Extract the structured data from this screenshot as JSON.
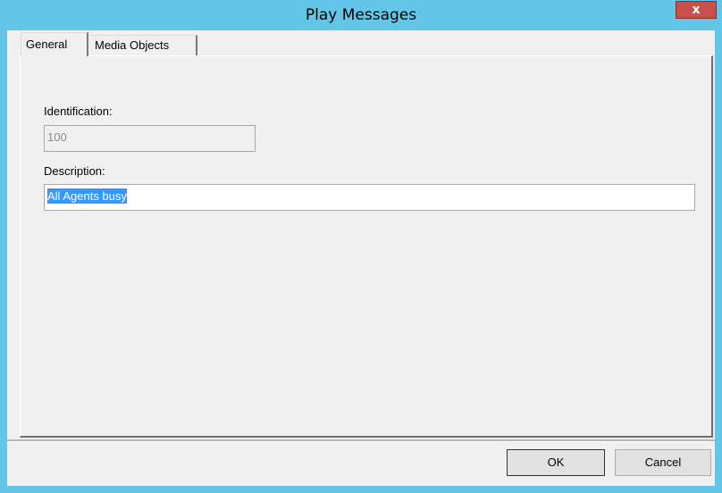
{
  "window": {
    "title": "Play Messages",
    "close_label": "x",
    "colors": {
      "titlebar": "#63c6e8",
      "close_button": "#c7504b",
      "panel": "#f0f0f0",
      "selection": "#3399ff"
    }
  },
  "tabs": [
    {
      "label": "General",
      "selected": true
    },
    {
      "label": "Media Objects",
      "selected": false
    }
  ],
  "general": {
    "identification_label": "Identification:",
    "identification_value": "100",
    "description_label": "Description:",
    "description_value": "All Agents busy"
  },
  "buttons": {
    "ok_label": "OK",
    "cancel_label": "Cancel"
  }
}
